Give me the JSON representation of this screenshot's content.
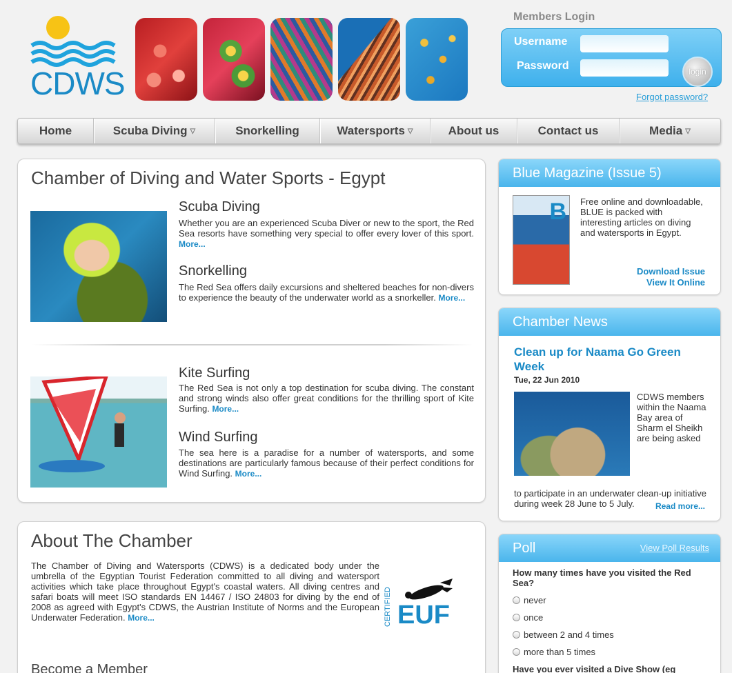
{
  "header": {
    "logo_text": "CDWS",
    "login": {
      "title": "Members Login",
      "username_label": "Username",
      "password_label": "Password",
      "login_button": "login",
      "forgot_link": "Forgot password?"
    }
  },
  "nav": {
    "items": [
      {
        "label": "Home"
      },
      {
        "label": "Scuba Diving"
      },
      {
        "label": "Snorkelling"
      },
      {
        "label": "Watersports"
      },
      {
        "label": "About us"
      },
      {
        "label": "Contact us"
      },
      {
        "label": "Media"
      }
    ]
  },
  "main": {
    "title": "Chamber of Diving and Water Sports - Egypt",
    "sections": [
      {
        "title": "Scuba Diving",
        "body": "Whether you are an experienced Scuba Diver or new to the sport, the Red Sea resorts have something very special to offer every lover of this sport.",
        "more": "More..."
      },
      {
        "title": "Snorkelling",
        "body": "The Red Sea offers daily excursions and sheltered beaches for non-divers to experience the beauty of the underwater world as a snorkeller.",
        "more": "More..."
      },
      {
        "title": "Kite Surfing",
        "body": "The Red Sea is not only a top destination for scuba diving. The constant and strong winds also offer great conditions for the thrilling sport of Kite Surfing.",
        "more": "More..."
      },
      {
        "title": "Wind Surfing",
        "body": "The sea here is a paradise for a number of watersports, and some destinations are particularly famous because of their perfect conditions for Wind Surfing.",
        "more": "More..."
      }
    ]
  },
  "about": {
    "title": "About The Chamber",
    "body": "The Chamber of Diving and Watersports (CDWS) is a dedicated body under the umbrella of the Egyptian Tourist Federation committed to all diving and watersport activities which take place throughout Egypt's coastal waters. All diving centres and safari boats will meet ISO standards EN 14467 / ISO 24803 for diving by the end of 2008 as agreed with Egypt's CDWS, the Austrian Institute of Norms and the European Underwater Federation.",
    "more": "More...",
    "badge_certified": "CERTIFIED",
    "badge_euf": "EUF",
    "member_title": "Become a Member"
  },
  "sidebar": {
    "magazine": {
      "title": "Blue Magazine (Issue 5)",
      "cover_letter": "B",
      "body": "Free online and downloadable, BLUE is packed with interesting articles on diving and watersports in Egypt.",
      "download": "Download Issue",
      "view": "View It Online"
    },
    "news": {
      "title": "Chamber News",
      "headline": "Clean up for Naama Go Green Week",
      "date": "Tue, 22 Jun 2010",
      "body_wrap": "CDWS members within the Naama Bay area of Sharm el Sheikh are being asked",
      "body_rest": "to participate in an underwater clean-up initiative during week 28 June to 5 July.",
      "read_more": "Read more..."
    },
    "poll": {
      "title": "Poll",
      "results_link": "View Poll Results",
      "question": "How many times have you visited the Red Sea?",
      "options": [
        "never",
        "once",
        "between 2 and 4 times",
        "more than 5 times"
      ],
      "next_question": "Have you ever visited a Dive Show (eg"
    }
  },
  "colors": {
    "accent": "#1a8ac6",
    "header_blue": "#4ab5ec"
  }
}
